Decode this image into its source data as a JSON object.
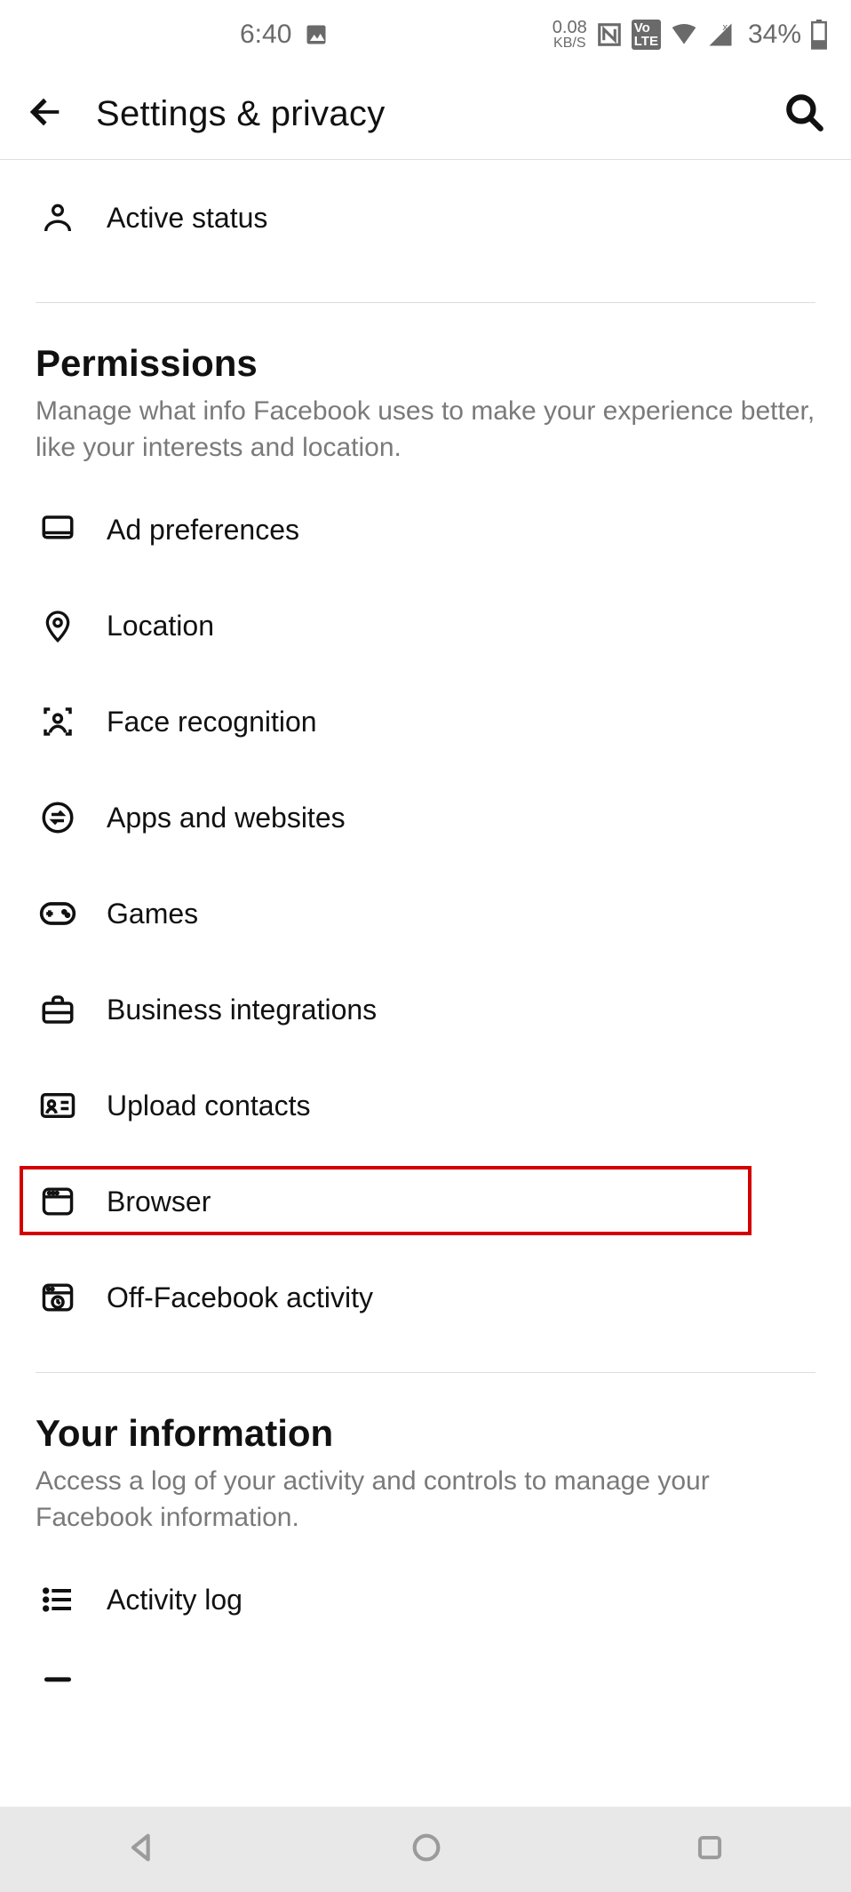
{
  "status": {
    "time": "6:40",
    "net_speed_value": "0.08",
    "net_speed_unit": "KB/S",
    "lte_label": "LTE",
    "battery_text": "34%"
  },
  "header": {
    "title": "Settings & privacy"
  },
  "top_items": [
    {
      "label": "Active status"
    }
  ],
  "sections": [
    {
      "title": "Permissions",
      "subtitle": "Manage what info Facebook uses to make your experience better, like your interests and location.",
      "items": [
        {
          "label": "Ad preferences"
        },
        {
          "label": "Location"
        },
        {
          "label": "Face recognition"
        },
        {
          "label": "Apps and websites"
        },
        {
          "label": "Games"
        },
        {
          "label": "Business integrations"
        },
        {
          "label": "Upload contacts"
        },
        {
          "label": "Browser"
        },
        {
          "label": "Off-Facebook activity"
        }
      ]
    },
    {
      "title": "Your information",
      "subtitle": "Access a log of your activity and controls to manage your Facebook information.",
      "items": [
        {
          "label": "Activity log"
        }
      ]
    }
  ],
  "highlighted_item_label": "Browser"
}
